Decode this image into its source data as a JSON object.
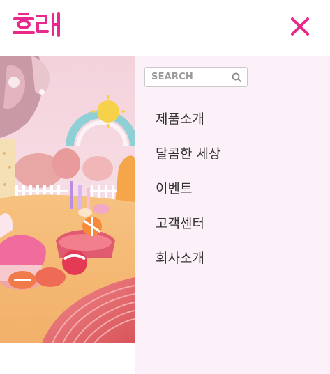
{
  "brand": {
    "logo_text": "하래",
    "color": "#e8288a"
  },
  "header": {
    "close_icon": "close-icon"
  },
  "search": {
    "placeholder": "SEARCH",
    "icon": "search-icon"
  },
  "menu": {
    "items": [
      {
        "label": "제품소개"
      },
      {
        "label": "달콤한 세상"
      },
      {
        "label": "이벤트"
      },
      {
        "label": "고객센터"
      },
      {
        "label": "회사소개"
      }
    ]
  },
  "colors": {
    "panel_bg": "#fdf1f9",
    "accent": "#e8288a",
    "text": "#333333"
  }
}
